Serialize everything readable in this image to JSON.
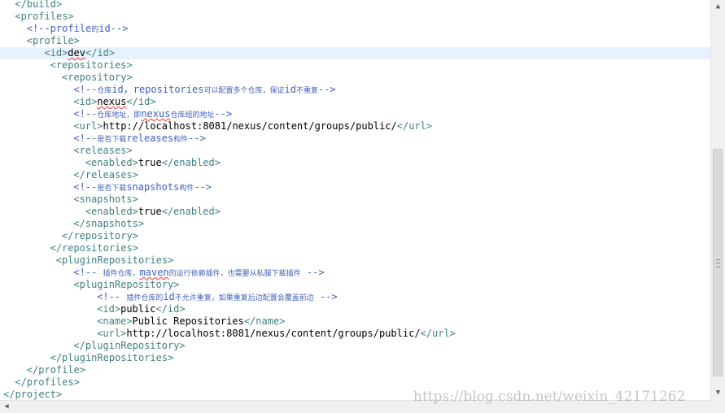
{
  "editor": {
    "lines": [
      {
        "indent": 2,
        "segments": [
          {
            "t": "</build>",
            "c": "tag"
          }
        ]
      },
      {
        "indent": 2,
        "segments": [
          {
            "t": "<profiles>",
            "c": "tag"
          }
        ]
      },
      {
        "indent": 4,
        "segments": [
          {
            "t": "<!--profile",
            "c": "comment"
          },
          {
            "t": "的",
            "c": "comment cjk"
          },
          {
            "t": "id-->",
            "c": "comment"
          }
        ]
      },
      {
        "indent": 4,
        "segments": [
          {
            "t": "<profile>",
            "c": "tag"
          }
        ]
      },
      {
        "indent": 7,
        "current": true,
        "segments": [
          {
            "t": "<id>",
            "c": "tag"
          },
          {
            "t": "dev",
            "c": "txt spell"
          },
          {
            "t": "</id>",
            "c": "tag"
          }
        ]
      },
      {
        "indent": 8,
        "segments": [
          {
            "t": "<repositories>",
            "c": "tag"
          }
        ]
      },
      {
        "indent": 10,
        "segments": [
          {
            "t": "<repository>",
            "c": "tag"
          }
        ]
      },
      {
        "indent": 12,
        "segments": [
          {
            "t": "<!--",
            "c": "comment"
          },
          {
            "t": "仓库",
            "c": "comment cjk"
          },
          {
            "t": "id，repositories",
            "c": "comment"
          },
          {
            "t": "可以配置多个仓库，保证",
            "c": "comment cjk"
          },
          {
            "t": "id",
            "c": "comment"
          },
          {
            "t": "不重复",
            "c": "comment cjk"
          },
          {
            "t": "-->",
            "c": "comment"
          }
        ]
      },
      {
        "indent": 12,
        "segments": [
          {
            "t": "<id>",
            "c": "tag"
          },
          {
            "t": "nexus",
            "c": "txt spell"
          },
          {
            "t": "</id>",
            "c": "tag"
          }
        ]
      },
      {
        "indent": 12,
        "segments": [
          {
            "t": "<!--",
            "c": "comment"
          },
          {
            "t": "仓库地址，即",
            "c": "comment cjk"
          },
          {
            "t": "nexus",
            "c": "comment spell"
          },
          {
            "t": "仓库组的地址",
            "c": "comment cjk"
          },
          {
            "t": "-->",
            "c": "comment"
          }
        ]
      },
      {
        "indent": 12,
        "segments": [
          {
            "t": "<url>",
            "c": "tag"
          },
          {
            "t": "http://localhost:8081/nexus/content/groups/public/",
            "c": "txt"
          },
          {
            "t": "</url>",
            "c": "tag"
          }
        ]
      },
      {
        "indent": 12,
        "segments": [
          {
            "t": "<!--",
            "c": "comment"
          },
          {
            "t": "是否下载",
            "c": "comment cjk"
          },
          {
            "t": "releases",
            "c": "comment"
          },
          {
            "t": "构件",
            "c": "comment cjk"
          },
          {
            "t": "-->",
            "c": "comment"
          }
        ]
      },
      {
        "indent": 12,
        "segments": [
          {
            "t": "<releases>",
            "c": "tag"
          }
        ]
      },
      {
        "indent": 14,
        "segments": [
          {
            "t": "<enabled>",
            "c": "tag"
          },
          {
            "t": "true",
            "c": "txt"
          },
          {
            "t": "</enabled>",
            "c": "tag"
          }
        ]
      },
      {
        "indent": 12,
        "segments": [
          {
            "t": "</releases>",
            "c": "tag"
          }
        ]
      },
      {
        "indent": 12,
        "segments": [
          {
            "t": "<!--",
            "c": "comment"
          },
          {
            "t": "是否下载",
            "c": "comment cjk"
          },
          {
            "t": "snapshots",
            "c": "comment"
          },
          {
            "t": "构件",
            "c": "comment cjk"
          },
          {
            "t": "-->",
            "c": "comment"
          }
        ]
      },
      {
        "indent": 12,
        "segments": [
          {
            "t": "<snapshots>",
            "c": "tag"
          }
        ]
      },
      {
        "indent": 14,
        "segments": [
          {
            "t": "<enabled>",
            "c": "tag"
          },
          {
            "t": "true",
            "c": "txt"
          },
          {
            "t": "</enabled>",
            "c": "tag"
          }
        ]
      },
      {
        "indent": 12,
        "segments": [
          {
            "t": "</snapshots>",
            "c": "tag"
          }
        ]
      },
      {
        "indent": 10,
        "segments": [
          {
            "t": "</repository>",
            "c": "tag"
          }
        ]
      },
      {
        "indent": 8,
        "segments": [
          {
            "t": "</repositories>",
            "c": "tag"
          }
        ]
      },
      {
        "indent": 9,
        "segments": [
          {
            "t": "<pluginRepositories>",
            "c": "tag"
          }
        ]
      },
      {
        "indent": 12,
        "segments": [
          {
            "t": "<!-- ",
            "c": "comment"
          },
          {
            "t": "插件仓库，",
            "c": "comment cjk"
          },
          {
            "t": "maven",
            "c": "comment spell"
          },
          {
            "t": "的运行依赖插件，也需要从私服下载插件",
            "c": "comment cjk"
          },
          {
            "t": " -->",
            "c": "comment"
          }
        ]
      },
      {
        "indent": 12,
        "segments": [
          {
            "t": "<pluginRepository>",
            "c": "tag"
          }
        ]
      },
      {
        "indent": 16,
        "segments": [
          {
            "t": "<!-- ",
            "c": "comment"
          },
          {
            "t": "插件仓库的",
            "c": "comment cjk"
          },
          {
            "t": "id",
            "c": "comment"
          },
          {
            "t": "不允许重复，如果重复后边配置会覆盖前边",
            "c": "comment cjk"
          },
          {
            "t": " -->",
            "c": "comment"
          }
        ]
      },
      {
        "indent": 16,
        "segments": [
          {
            "t": "<id>",
            "c": "tag"
          },
          {
            "t": "public",
            "c": "txt"
          },
          {
            "t": "</id>",
            "c": "tag"
          }
        ]
      },
      {
        "indent": 16,
        "segments": [
          {
            "t": "<name>",
            "c": "tag"
          },
          {
            "t": "Public Repositories",
            "c": "txt"
          },
          {
            "t": "</name>",
            "c": "tag"
          }
        ]
      },
      {
        "indent": 16,
        "segments": [
          {
            "t": "<url>",
            "c": "tag"
          },
          {
            "t": "http://localhost:8081/nexus/content/groups/public/",
            "c": "txt"
          },
          {
            "t": "</url>",
            "c": "tag"
          }
        ]
      },
      {
        "indent": 12,
        "segments": [
          {
            "t": "</pluginRepository>",
            "c": "tag"
          }
        ]
      },
      {
        "indent": 8,
        "segments": [
          {
            "t": "</pluginRepositories>",
            "c": "tag"
          }
        ]
      },
      {
        "indent": 4,
        "segments": [
          {
            "t": "</profile>",
            "c": "tag"
          }
        ]
      },
      {
        "indent": 2,
        "segments": [
          {
            "t": "</profiles>",
            "c": "tag"
          }
        ]
      },
      {
        "indent": 0,
        "segments": [
          {
            "t": "</project>",
            "c": "tag"
          }
        ]
      }
    ]
  },
  "scrollbars": {
    "vertical_up_arrow": "▲",
    "vertical_down_arrow": "▼",
    "horizontal_left_arrow": "◀"
  },
  "watermark": "https://blog.csdn.net/weixin_42171262",
  "colors": {
    "tag": "#3f7f7f",
    "comment": "#3f5fbf",
    "text": "#000000",
    "current_line": "#e8f2fe"
  }
}
